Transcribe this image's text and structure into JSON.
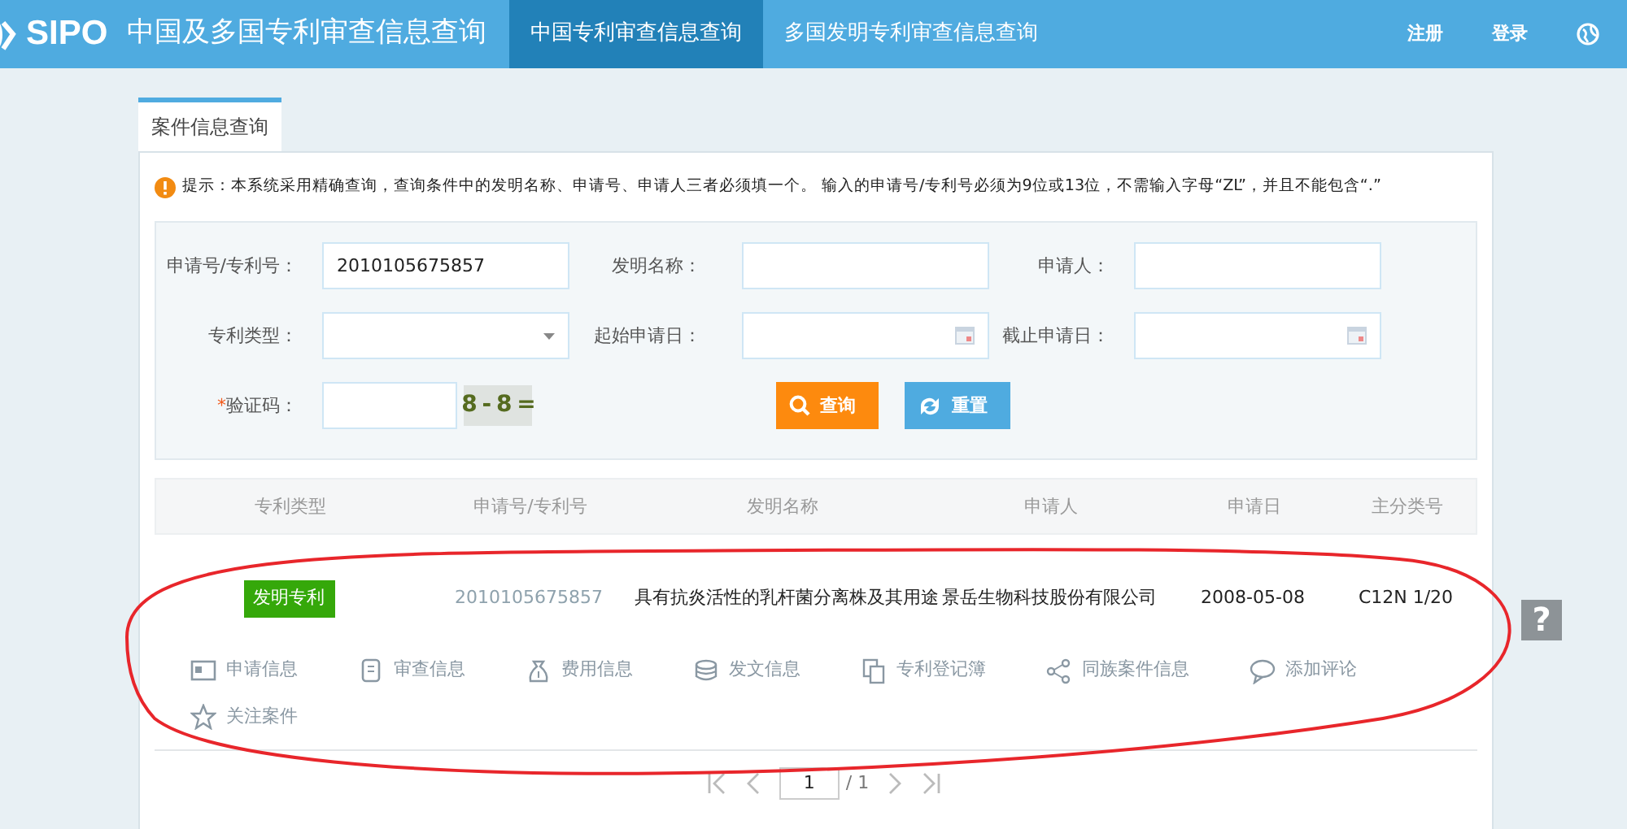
{
  "header": {
    "logo_text": "SIPO",
    "site_title": "中国及多国专利审查信息查询",
    "nav": [
      {
        "label": "中国专利审查信息查询",
        "selected": true
      },
      {
        "label": "多国发明专利审查信息查询",
        "selected": false
      }
    ],
    "links": [
      "注册",
      "登录"
    ]
  },
  "tabs": [
    {
      "label": "案件信息查询",
      "selected": true
    }
  ],
  "notice": "提示：本系统采用精确查询，查询条件中的发明名称、申请号、申请人三者必须填一个。 输入的申请号/专利号必须为9位或13位，不需输入字母“ZL”，并且不能包含“.”",
  "form": {
    "fields": [
      {
        "label": "申请号/专利号：",
        "kind": "text",
        "value": "2010105675857"
      },
      {
        "label": "发明名称：",
        "kind": "text"
      },
      {
        "label": "申请人：",
        "kind": "text"
      },
      {
        "label": "专利类型：",
        "kind": "select"
      },
      {
        "label": "起始申请日：",
        "kind": "date"
      },
      {
        "label": "截止申请日：",
        "kind": "date"
      },
      {
        "label": "验证码：",
        "kind": "captcha",
        "required_mark": "*",
        "captcha_text": "8 - 8 ="
      }
    ],
    "buttons": [
      {
        "label": "查询",
        "kind": "search"
      },
      {
        "label": "重置",
        "kind": "reset"
      }
    ]
  },
  "table": {
    "columns": [
      "专利类型",
      "申请号/专利号",
      "发明名称",
      "申请人",
      "申请日",
      "主分类号"
    ],
    "rows": [
      {
        "cells": [
          {
            "text": "发明专利",
            "kind": "badge"
          },
          {
            "text": "2010105675857",
            "kind": "muted"
          },
          {
            "text": "具有抗炎活性的乳杆菌分离株及其用途",
            "kind": "plain"
          },
          {
            "text": "景岳生物科技股份有限公司",
            "kind": "plain"
          },
          {
            "text": "2008-05-08",
            "kind": "plain"
          },
          {
            "text": "C12N 1/20",
            "kind": "plain"
          }
        ],
        "actions": [
          {
            "label": "申请信息",
            "kind": "card"
          },
          {
            "label": "审查信息",
            "kind": "doc"
          },
          {
            "label": "费用信息",
            "kind": "bag"
          },
          {
            "label": "发文信息",
            "kind": "coins"
          },
          {
            "label": "专利登记簿",
            "kind": "copy"
          },
          {
            "label": "同族案件信息",
            "kind": "share"
          },
          {
            "label": "添加评论",
            "kind": "comment"
          },
          {
            "label": "关注案件",
            "kind": "star"
          }
        ]
      }
    ]
  },
  "pagination": {
    "page": "1",
    "total": "/ 1"
  },
  "help_button": "?",
  "annotation": {
    "kind": "ellipse"
  }
}
